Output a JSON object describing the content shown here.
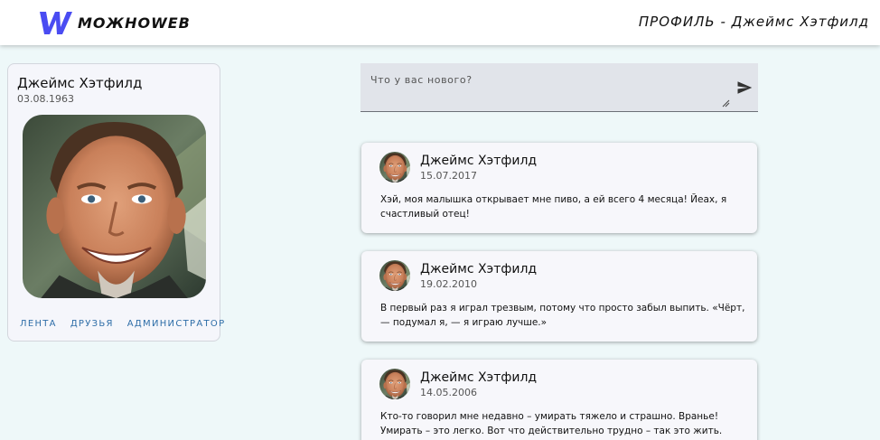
{
  "header": {
    "logo_text": "МОЖНОWEB",
    "title": "ПРОФИЛЬ - Джеймс Хэтфилд"
  },
  "colors": {
    "accent": "#4a4cf2",
    "link": "#2f6ea8",
    "background": "#eef8f9"
  },
  "profile": {
    "name": "Джеймс Хэтфилд",
    "birth_date": "03.08.1963",
    "links": [
      "ЛЕНТА",
      "ДРУЗЬЯ",
      "АДМИНИСТРАТОР"
    ]
  },
  "composer": {
    "placeholder": "Что у вас нового?",
    "send_icon": "send-icon"
  },
  "posts": [
    {
      "author": "Джеймс Хэтфилд",
      "date": "15.07.2017",
      "text": "Хэй, моя малышка открывает мне пиво, а ей всего 4 месяца! Йеах, я счастливый отец!"
    },
    {
      "author": "Джеймс Хэтфилд",
      "date": "19.02.2010",
      "text": "В первый раз я играл трезвым, потому что просто забыл выпить. «Чёрт, — подумал я, — я играю лучше.»"
    },
    {
      "author": "Джеймс Хэтфилд",
      "date": "14.05.2006",
      "text": "Кто-то говорил мне недавно – умирать тяжело и страшно. Вранье! Умирать – это легко. Вот что действительно трудно – так это жить."
    }
  ]
}
